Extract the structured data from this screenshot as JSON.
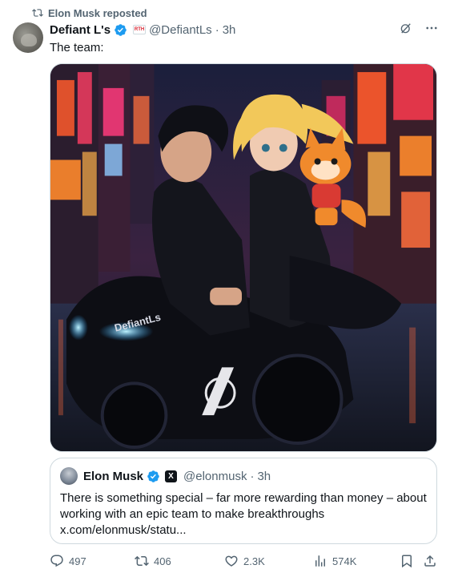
{
  "repost": {
    "label": "Elon Musk reposted"
  },
  "tweet": {
    "author": {
      "display_name": "Defiant L's",
      "handle": "@DefiantLs",
      "affiliation": "RTH"
    },
    "separator": "·",
    "time": "3h",
    "text": "The team:",
    "media": {
      "watermark": "DefiantLs"
    }
  },
  "quote": {
    "author": {
      "display_name": "Elon Musk",
      "handle": "@elonmusk",
      "badge": "X"
    },
    "separator": "·",
    "time": "3h",
    "text": "There is something special – far more rewarding than money – about working with an epic team to make breakthroughs x.com/elonmusk/statu..."
  },
  "actions": {
    "replies": "497",
    "reposts": "406",
    "likes": "2.3K",
    "views": "574K"
  },
  "colors": {
    "verified": "#1d9bf0",
    "muted": "#536471",
    "text": "#0f1419",
    "border": "#cfd9de"
  }
}
